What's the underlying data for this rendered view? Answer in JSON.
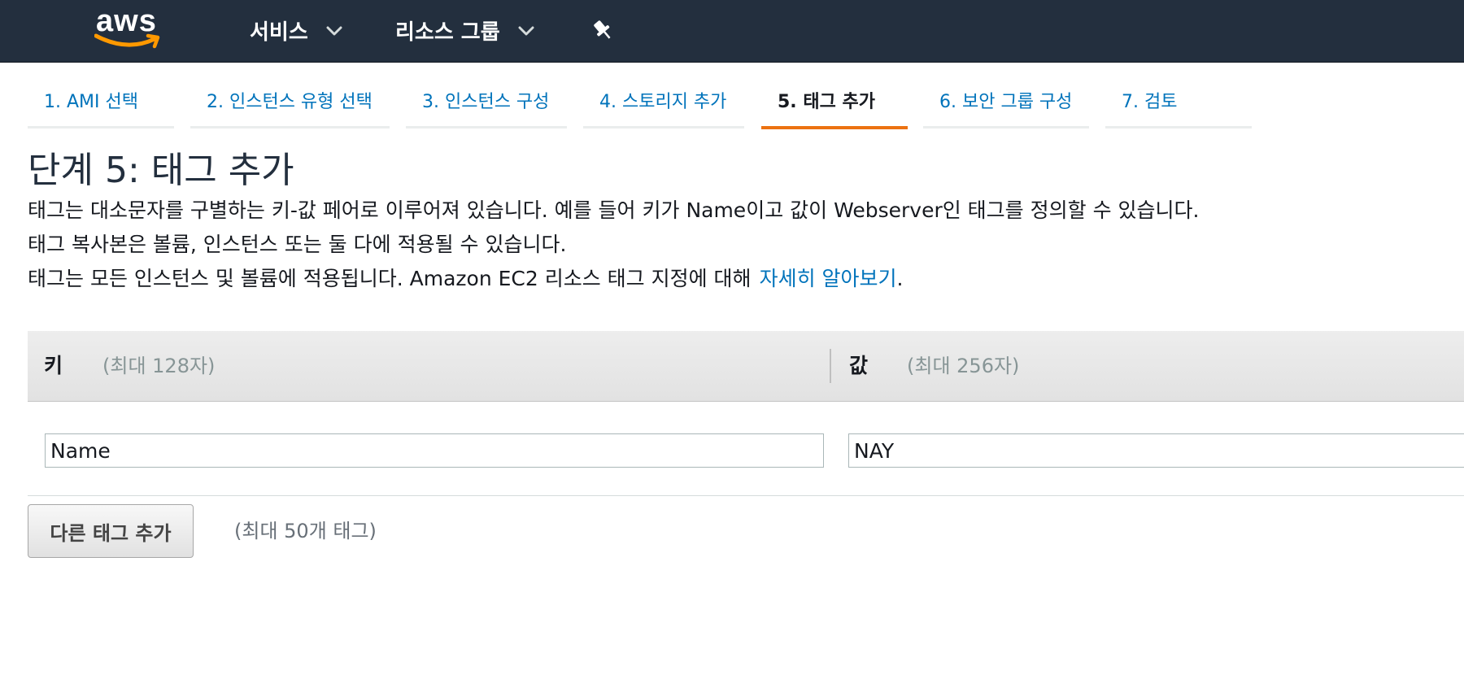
{
  "topnav": {
    "logo_text": "aws",
    "services_label": "서비스",
    "resource_groups_label": "리소스 그룹",
    "icons": [
      "aws-smile-logo",
      "chevron-down-icon",
      "pin-icon"
    ]
  },
  "steps": [
    {
      "label": "1. AMI 선택",
      "active": false
    },
    {
      "label": "2. 인스턴스 유형 선택",
      "active": false
    },
    {
      "label": "3. 인스턴스 구성",
      "active": false
    },
    {
      "label": "4. 스토리지 추가",
      "active": false
    },
    {
      "label": "5. 태그 추가",
      "active": true
    },
    {
      "label": "6. 보안 그룹 구성",
      "active": false
    },
    {
      "label": "7. 검토",
      "active": false
    }
  ],
  "page": {
    "title": "단계 5: 태그 추가",
    "description_line1": "태그는 대소문자를 구별하는 키-값 페어로 이루어져 있습니다. 예를 들어 키가 Name이고 값이 Webserver인 태그를 정의할 수 있습니다.",
    "description_line2": "태그 복사본은 볼륨, 인스턴스 또는 둘 다에 적용될 수 있습니다.",
    "description_line3": "태그는 모든 인스턴스 및 볼륨에 적용됩니다. Amazon EC2 리소스 태그 지정에 대해",
    "learn_more_link": "자세히 알아보기",
    "learn_more_suffix": "."
  },
  "tag_table": {
    "key_label": "키",
    "key_hint": "(최대 128자)",
    "value_label": "값",
    "value_hint": "(최대 256자)",
    "rows": [
      {
        "key": "Name",
        "value": "NAY"
      }
    ]
  },
  "add_tag": {
    "button_label": "다른 태그 추가",
    "hint": "(최대 50개 태그)"
  },
  "colors": {
    "nav_bg": "#232f3e",
    "link": "#0073bb",
    "active_step": "#ec7211",
    "logo_smile": "#ff9900"
  }
}
